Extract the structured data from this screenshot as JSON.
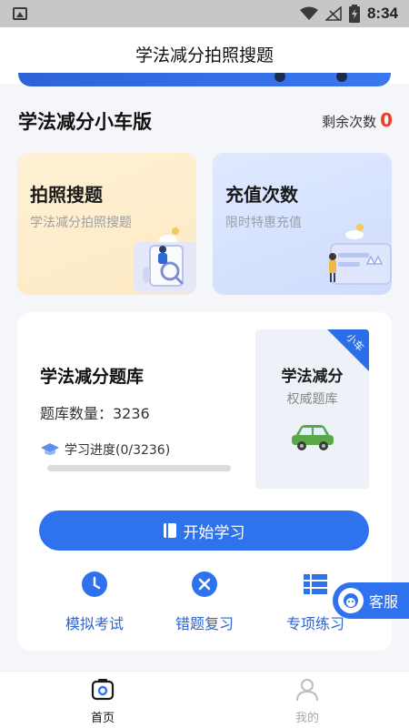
{
  "status_bar": {
    "time": "8:34"
  },
  "header": {
    "title": "学法减分拍照搜题"
  },
  "section": {
    "title": "学法减分小车版",
    "remain_label": "剩余次数",
    "remain_count": "0"
  },
  "cards": [
    {
      "title": "拍照搜题",
      "subtitle": "学法减分拍照搜题"
    },
    {
      "title": "充值次数",
      "subtitle": "限时特惠充值"
    }
  ],
  "bank": {
    "title": "学法减分题库",
    "count_text": "题库数量：3236",
    "progress_text": "学习进度(0/3236)",
    "progress_fraction": 0,
    "badge_title": "学法减分",
    "badge_subtitle": "权威题库",
    "corner_tag": "小车"
  },
  "start_button": {
    "label": "开始学习"
  },
  "quick_actions": [
    {
      "label": "模拟考试",
      "icon": "clock-icon"
    },
    {
      "label": "错题复习",
      "icon": "close-circle-icon"
    },
    {
      "label": "专项练习",
      "icon": "list-icon"
    }
  ],
  "service_button": {
    "label": "客服"
  },
  "tabs": [
    {
      "label": "首页",
      "active": true
    },
    {
      "label": "我的",
      "active": false
    }
  ],
  "colors": {
    "accent": "#2f72ee",
    "remain_red": "#f03c2a",
    "quick_text": "#2b64d6"
  }
}
